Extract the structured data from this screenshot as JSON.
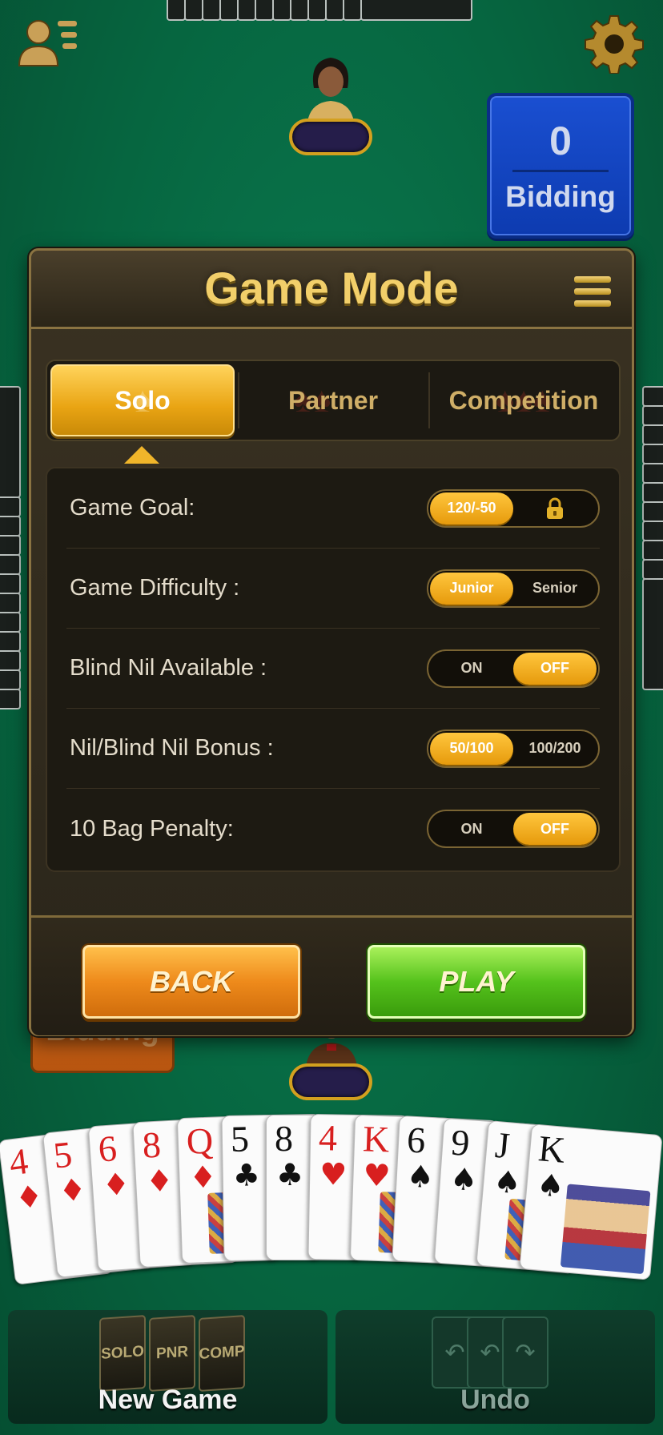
{
  "table": {
    "bidding_top": {
      "value": "0",
      "label": "Bidding"
    },
    "bidding_bottom": {
      "label": "Bidding"
    }
  },
  "modal": {
    "title": "Game Mode",
    "tabs": [
      {
        "label": "Solo",
        "active": true
      },
      {
        "label": "Partner",
        "active": false
      },
      {
        "label": "Competition",
        "active": false
      }
    ],
    "settings": [
      {
        "label": "Game Goal:",
        "options": [
          "120/-50",
          "lock-icon"
        ],
        "selected": 0
      },
      {
        "label": "Game Difficulty :",
        "options": [
          "Junior",
          "Senior"
        ],
        "selected": 0
      },
      {
        "label": "Blind Nil Available :",
        "options": [
          "ON",
          "OFF"
        ],
        "selected": 1
      },
      {
        "label": "Nil/Blind Nil Bonus :",
        "options": [
          "50/100",
          "100/200"
        ],
        "selected": 0
      },
      {
        "label": "10 Bag Penalty:",
        "options": [
          "ON",
          "OFF"
        ],
        "selected": 1
      }
    ],
    "back_label": "BACK",
    "play_label": "PLAY"
  },
  "hand": [
    {
      "rank": "4",
      "suit": "♦",
      "color": "red"
    },
    {
      "rank": "5",
      "suit": "♦",
      "color": "red"
    },
    {
      "rank": "6",
      "suit": "♦",
      "color": "red"
    },
    {
      "rank": "8",
      "suit": "♦",
      "color": "red"
    },
    {
      "rank": "Q",
      "suit": "♦",
      "color": "red"
    },
    {
      "rank": "5",
      "suit": "♣",
      "color": "black"
    },
    {
      "rank": "8",
      "suit": "♣",
      "color": "black"
    },
    {
      "rank": "4",
      "suit": "♥",
      "color": "red"
    },
    {
      "rank": "K",
      "suit": "♥",
      "color": "red"
    },
    {
      "rank": "6",
      "suit": "♠",
      "color": "black"
    },
    {
      "rank": "9",
      "suit": "♠",
      "color": "black"
    },
    {
      "rank": "J",
      "suit": "♠",
      "color": "black"
    },
    {
      "rank": "K",
      "suit": "♠",
      "color": "black"
    }
  ],
  "bottom_bar": {
    "new_game_label": "New Game",
    "new_game_decks": [
      "SOLO",
      "PNR",
      "COMP"
    ],
    "undo_label": "Undo"
  },
  "colors": {
    "felt": "#066640",
    "gold": "#f2cf6a",
    "bid_blue": "#1a4fd1",
    "play_green": "#55c21c",
    "back_orange": "#ee8a1b"
  }
}
